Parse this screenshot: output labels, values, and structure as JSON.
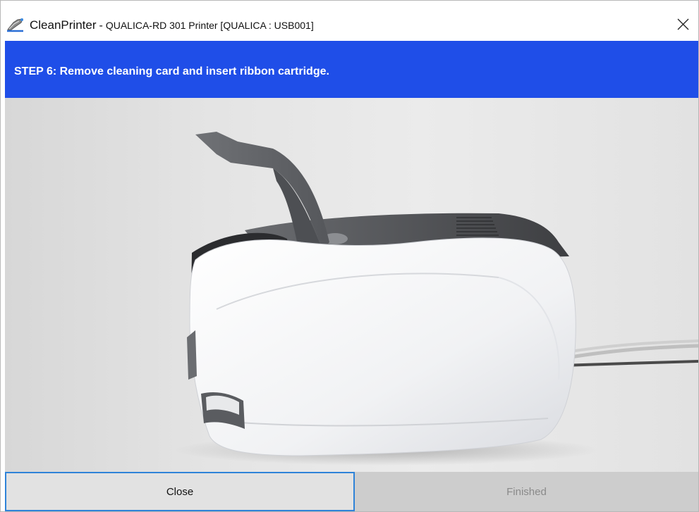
{
  "window": {
    "app_name": "CleanPrinter",
    "separator": "-",
    "printer_name": "QUALICA-RD 301 Printer [QUALICA : USB001]"
  },
  "step": {
    "instruction": "STEP 6:  Remove cleaning card and insert ribbon cartridge."
  },
  "illustration": {
    "icon": "card-printer-open-lid-photo"
  },
  "buttons": {
    "close_label": "Close",
    "finished_label": "Finished"
  },
  "colors": {
    "banner": "#1f4ee8",
    "focus_border": "#2f83d8",
    "disabled_button": "#cdcdcd"
  }
}
